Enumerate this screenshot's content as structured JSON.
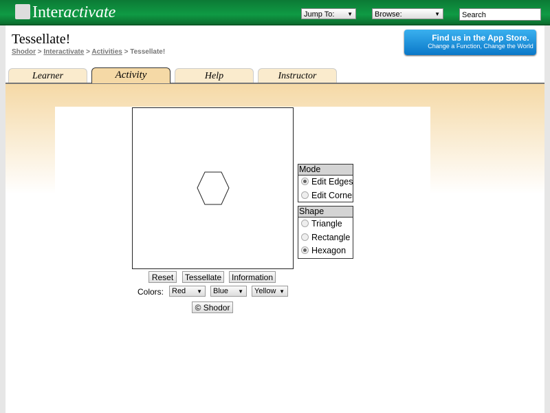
{
  "header": {
    "logo_plain": "Inter",
    "logo_italic": "activate",
    "jump_to": "Jump To:",
    "browse": "Browse:",
    "search_placeholder": "Search"
  },
  "page": {
    "title": "Tessellate!",
    "breadcrumb": [
      "Shodor",
      "Interactivate",
      "Activities",
      "Tessellate!"
    ]
  },
  "appstore": {
    "line1": "Find us in the App Store.",
    "line2": "Change a Function, Change the World"
  },
  "tabs": [
    {
      "label": "Learner"
    },
    {
      "label": "Activity",
      "active": true
    },
    {
      "label": "Help"
    },
    {
      "label": "Instructor"
    }
  ],
  "mode": {
    "title": "Mode",
    "options": [
      {
        "label": "Edit Edges",
        "checked": true
      },
      {
        "label": "Edit Corners",
        "checked": false
      }
    ]
  },
  "shape": {
    "title": "Shape",
    "options": [
      {
        "label": "Triangle",
        "checked": false
      },
      {
        "label": "Rectangle",
        "checked": false
      },
      {
        "label": "Hexagon",
        "checked": true
      }
    ]
  },
  "buttons": {
    "reset": "Reset",
    "tessellate": "Tessellate",
    "information": "Information",
    "shodor": "© Shodor"
  },
  "colors": {
    "label": "Colors:",
    "selected": [
      "Red",
      "Blue",
      "Yellow"
    ]
  }
}
